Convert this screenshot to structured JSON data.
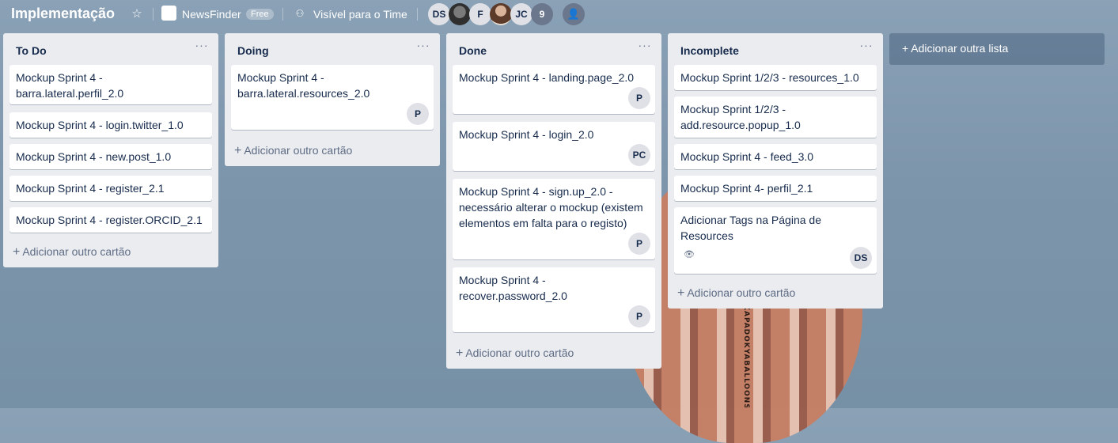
{
  "header": {
    "board_title": "Implementação",
    "org_name": "NewsFinder",
    "org_badge": "Free",
    "visibility": "Visível para o Time",
    "members": [
      "DS",
      "",
      "F",
      "",
      "JC"
    ],
    "member_count": "9"
  },
  "lists": [
    {
      "title": "To Do",
      "cards": [
        {
          "text": "Mockup Sprint 4 - barra.lateral.perfil_2.0"
        },
        {
          "text": "Mockup Sprint 4 - login.twitter_1.0"
        },
        {
          "text": "Mockup Sprint 4 - new.post_1.0"
        },
        {
          "text": "Mockup Sprint 4 - register_2.1"
        },
        {
          "text": "Mockup Sprint 4 - register.ORCID_2.1"
        }
      ],
      "add_card": "Adicionar outro cartão"
    },
    {
      "title": "Doing",
      "cards": [
        {
          "text": "Mockup Sprint 4 - barra.lateral.resources_2.0",
          "member": "P"
        }
      ],
      "add_card": "Adicionar outro cartão"
    },
    {
      "title": "Done",
      "cards": [
        {
          "text": "Mockup Sprint 4 - landing.page_2.0",
          "member": "P"
        },
        {
          "text": "Mockup Sprint 4 - login_2.0",
          "member": "PC"
        },
        {
          "text": "Mockup Sprint 4 - sign.up_2.0 - necessário alterar o mockup (existem elementos em falta para o registo)",
          "member": "P"
        },
        {
          "text": "Mockup Sprint 4 - recover.password_2.0",
          "member": "P"
        }
      ],
      "add_card": "Adicionar outro cartão"
    },
    {
      "title": "Incomplete",
      "cards": [
        {
          "text": "Mockup Sprint 1/2/3 - resources_1.0"
        },
        {
          "text": "Mockup Sprint 1/2/3 - add.resource.popup_1.0"
        },
        {
          "text": "Mockup Sprint 4 - feed_3.0"
        },
        {
          "text": "Mockup Sprint 4- perfil_2.1"
        },
        {
          "text": "Adicionar Tags na Página de Resources",
          "member": "DS"
        }
      ],
      "add_card": "Adicionar outro cartão"
    }
  ],
  "add_list": "+ Adicionar outra lista",
  "balloon_text": "KAPADOKYABALLOONS",
  "icons": {
    "star": "star-icon",
    "visibility": "team-visibility-icon",
    "invite": "invite-member-icon",
    "list_menu": "more-horizontal-icon",
    "watch": "eye-icon",
    "plus": "plus-icon"
  }
}
